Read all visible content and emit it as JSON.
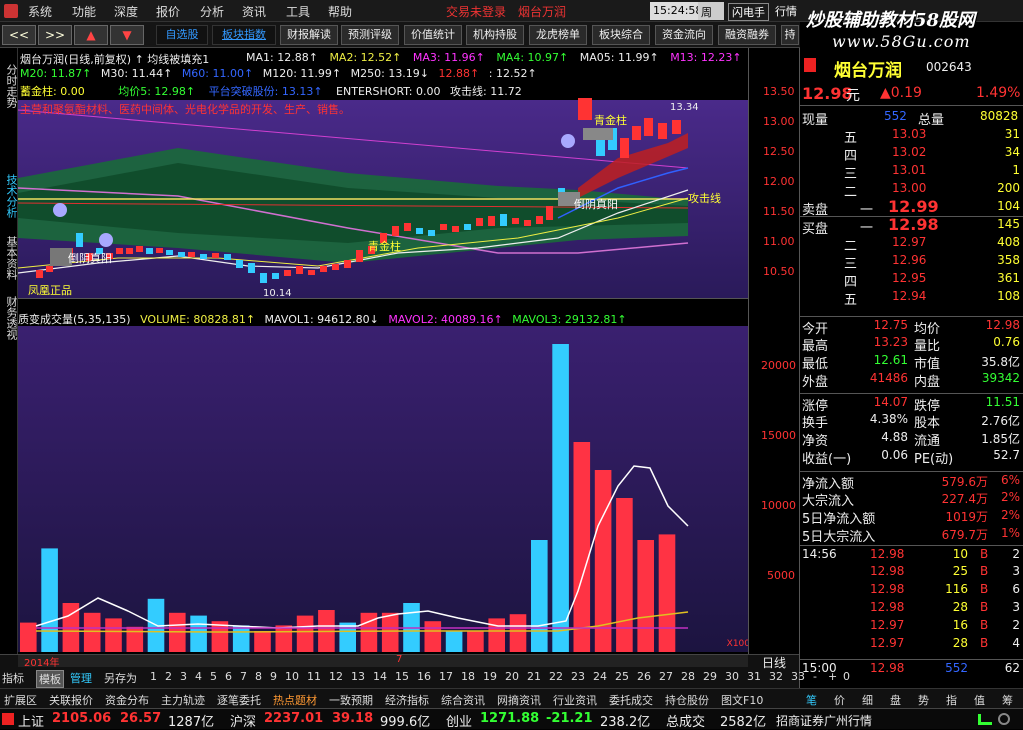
{
  "menu": {
    "items": [
      "系统",
      "功能",
      "深度",
      "报价",
      "分析",
      "资讯",
      "工具",
      "帮助"
    ],
    "warning": "交易未登录",
    "stock_title": "烟台万润",
    "time": "15:24:58",
    "weekday": "周四",
    "flash": "闪电手",
    "market": "行情"
  },
  "watermark": {
    "line1": "炒股辅助教材58股网",
    "line2": "www.58Gu.com"
  },
  "toolbar": {
    "nav": [
      "<<",
      ">>",
      "▲",
      "▼"
    ],
    "tabs": [
      "自选股",
      "板块指数",
      "财报解读",
      "预测评级",
      "价值统计",
      "机构持股",
      "龙虎榜单",
      "板块综合",
      "资金流向",
      "融资融券",
      "持"
    ]
  },
  "left_tabs": [
    "分时走势",
    "技术分析",
    "基本资料",
    "财务透视"
  ],
  "kline": {
    "header1": "烟台万润(日线,前复权) ↑ 均线被填充1",
    "ma": [
      "MA1: 12.88↑",
      "MA2: 12.52↑",
      "MA3: 11.96↑",
      "MA4: 10.97↑",
      "MA05: 11.99↑",
      "M13: 12.23↑"
    ],
    "ma2": [
      "M20: 11.87↑",
      "M30: 11.44↑",
      "M60: 11.00↑",
      "M120: 11.99↑",
      "M250: 13.19↓",
      "12.88↑",
      ": 12.52↑"
    ],
    "line3": [
      "蓄金柱: 0.00",
      "均价5: 12.98↑",
      "平台突破股份: 13.13↑",
      "ENTERSHORT: 0.00",
      "攻击线: 11.72"
    ],
    "subtitle": "主营和聚氨酯材料、医药中间体、光电化学品的开发、生产、销售。",
    "labels": {
      "peak": "13.34",
      "low": "10.14",
      "gold1": "青金柱",
      "gold2": "青金柱",
      "pillar": "倒阴真阳",
      "pillar2": "倒阴真阳",
      "phoenix": "凤凰正品",
      "attack": "攻击线"
    },
    "axis": [
      "13.50",
      "13.00",
      "12.50",
      "12.00",
      "11.50",
      "11.00",
      "10.50"
    ]
  },
  "volume": {
    "header": [
      "质变成交量(5,35,135)",
      "VOLUME: 80828.81↑",
      "MAVOL1: 94612.80↓",
      "MAVOL2: 40089.16↑",
      "MAVOL3: 29132.81↑"
    ],
    "axis": [
      "20000",
      "15000",
      "10000",
      "5000"
    ],
    "unit": "X100",
    "date": "2014年",
    "month": "7"
  },
  "chart_data": {
    "type": "bar",
    "xlabel": "",
    "ylabel": "",
    "ylim": [
      0,
      23000
    ],
    "categories": [
      "1",
      "2",
      "3",
      "4",
      "5",
      "6",
      "7",
      "8",
      "9",
      "10",
      "11",
      "12",
      "13",
      "14",
      "15",
      "16",
      "17",
      "18",
      "19",
      "20",
      "21",
      "22",
      "23",
      "24",
      "25",
      "26",
      "27",
      "28",
      "29",
      "30",
      "31"
    ],
    "values": [
      2100,
      7400,
      3500,
      2800,
      2400,
      1800,
      3800,
      2800,
      2600,
      2200,
      1900,
      1500,
      1900,
      2600,
      3000,
      2100,
      2800,
      2800,
      3500,
      2200,
      1500,
      1500,
      2400,
      2700,
      8000,
      22000,
      15000,
      13000,
      11000,
      8000,
      8400
    ]
  },
  "bottom": {
    "tabs": [
      "指标",
      "模板",
      "管理",
      "另存为",
      "1",
      "2",
      "3",
      "4",
      "5",
      "6",
      "7",
      "8",
      "9",
      "10",
      "11",
      "12",
      "13",
      "14",
      "15",
      "16",
      "17",
      "18",
      "19",
      "20",
      "21",
      "22",
      "23",
      "24",
      "25",
      "26",
      "27",
      "28",
      "29",
      "30",
      "31",
      "32",
      "33",
      "-",
      "+",
      "0"
    ],
    "period": "日线",
    "tabs2": [
      "扩展区",
      "关联报价",
      "资金分布",
      "主力轨迹",
      "逐笔委托",
      "热点题材",
      "一致预期",
      "经济指标",
      "综合资讯",
      "网摘资讯",
      "行业资讯",
      "委托成交",
      "持仓股份",
      "图文F10"
    ],
    "right_icons": [
      "笔",
      "价",
      "细",
      "盘",
      "势",
      "指",
      "值",
      "筹"
    ]
  },
  "quote": {
    "name": "烟台万润",
    "code": "002643",
    "price": "12.98",
    "unit": "元",
    "change": "▲0.19",
    "pct": "1.49%",
    "xl_label": "现量",
    "xl": "552",
    "zl_label": "总量",
    "zl": "80828",
    "sell": [
      {
        "lvl": "五",
        "price": "13.03",
        "vol": "31"
      },
      {
        "lvl": "四",
        "price": "13.02",
        "vol": "34"
      },
      {
        "lvl": "三",
        "price": "13.01",
        "vol": "1"
      },
      {
        "lvl": "二",
        "price": "13.00",
        "vol": "200"
      },
      {
        "lvl": "一",
        "price": "12.99",
        "vol": "104"
      }
    ],
    "sell_label": "卖盘",
    "buy_label": "买盘",
    "buy": [
      {
        "lvl": "一",
        "price": "12.98",
        "vol": "145"
      },
      {
        "lvl": "二",
        "price": "12.97",
        "vol": "408"
      },
      {
        "lvl": "三",
        "price": "12.96",
        "vol": "358"
      },
      {
        "lvl": "四",
        "price": "12.95",
        "vol": "361"
      },
      {
        "lvl": "五",
        "price": "12.94",
        "vol": "108"
      }
    ],
    "stats": [
      {
        "l1": "今开",
        "v1": "12.75",
        "l2": "均价",
        "v2": "12.98",
        "c1": "red",
        "c2": "red"
      },
      {
        "l1": "最高",
        "v1": "13.23",
        "l2": "量比",
        "v2": "0.76",
        "c1": "red",
        "c2": "yellow"
      },
      {
        "l1": "最低",
        "v1": "12.61",
        "l2": "市值",
        "v2": "35.8亿",
        "c1": "green",
        "c2": "white"
      },
      {
        "l1": "外盘",
        "v1": "41486",
        "l2": "内盘",
        "v2": "39342",
        "c1": "red",
        "c2": "green"
      },
      {
        "l1": "涨停",
        "v1": "14.07",
        "l2": "跌停",
        "v2": "11.51",
        "c1": "red",
        "c2": "green"
      },
      {
        "l1": "换手",
        "v1": "4.38%",
        "l2": "股本",
        "v2": "2.76亿",
        "c1": "white",
        "c2": "white"
      },
      {
        "l1": "净资",
        "v1": "4.88",
        "l2": "流通",
        "v2": "1.85亿",
        "c1": "white",
        "c2": "white"
      },
      {
        "l1": "收益(一)",
        "v1": "0.06",
        "l2": "PE(动)",
        "v2": "52.7",
        "c1": "white",
        "c2": "white"
      }
    ],
    "flows": [
      {
        "l": "净流入额",
        "v": "579.6万",
        "p": "6%"
      },
      {
        "l": "大宗流入",
        "v": "227.4万",
        "p": "2%"
      },
      {
        "l": "5日净流入额",
        "v": "1019万",
        "p": "2%"
      },
      {
        "l": "5日大宗流入",
        "v": "679.7万",
        "p": "1%"
      }
    ],
    "ticks": [
      {
        "t": "14:56",
        "p": "12.98",
        "v": "10",
        "s": "B",
        "n": "2"
      },
      {
        "t": "",
        "p": "12.98",
        "v": "25",
        "s": "B",
        "n": "3"
      },
      {
        "t": "",
        "p": "12.98",
        "v": "116",
        "s": "B",
        "n": "6"
      },
      {
        "t": "",
        "p": "12.98",
        "v": "28",
        "s": "B",
        "n": "3"
      },
      {
        "t": "",
        "p": "12.97",
        "v": "16",
        "s": "B",
        "n": "2"
      },
      {
        "t": "",
        "p": "12.97",
        "v": "28",
        "s": "B",
        "n": "4"
      },
      {
        "t": "15:00",
        "p": "12.98",
        "v": "552",
        "s": "",
        "n": "62"
      }
    ]
  },
  "status": {
    "sh_label": "上证",
    "sh": "2105.06",
    "sh_chg": "26.57",
    "sh_amt": "1287亿",
    "sz_label": "沪深",
    "sz": "2237.01",
    "sz_chg": "39.18",
    "sz_amt": "999.6亿",
    "cy_label": "创业",
    "cy": "1271.88",
    "cy_chg": "-21.21",
    "cy_amt": "238.2亿",
    "total_label": "总成交",
    "total": "2582亿",
    "broker": "招商证券广州行情"
  }
}
